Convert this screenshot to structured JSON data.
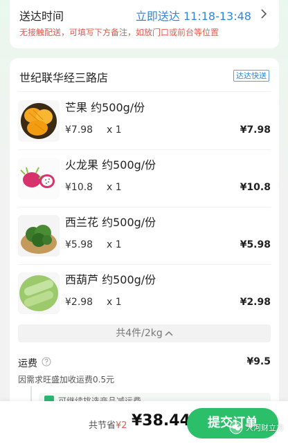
{
  "delivery": {
    "title": "送达时间",
    "time": "立即送达 11:18-13:48",
    "note": "无接触配送，可填写下方备注，如放门口或前台等位置"
  },
  "store": {
    "name": "世纪联华经三路店",
    "badge": "达达快送"
  },
  "items": [
    {
      "name": "芒果 约500g/份",
      "price": "¥7.98",
      "qty": "x 1",
      "total": "¥7.98",
      "icon": "mango-image"
    },
    {
      "name": "火龙果 约500g/份",
      "price": "¥10.8",
      "qty": "x 1",
      "total": "¥10.8",
      "icon": "dragon-fruit-image"
    },
    {
      "name": "西兰花 约500g/份",
      "price": "¥5.98",
      "qty": "x 1",
      "total": "¥5.98",
      "icon": "broccoli-image"
    },
    {
      "name": "西葫芦 约500g/份",
      "price": "¥2.98",
      "qty": "x 1",
      "total": "¥2.98",
      "icon": "zucchini-image"
    }
  ],
  "summary": {
    "text": "共4件/2kg"
  },
  "fee": {
    "label": "运费",
    "value": "¥9.5",
    "note": "因需求旺盛加收运费0.5元"
  },
  "promo": {
    "text": "可继续挑选商品减运费"
  },
  "checkout": {
    "saved_label": "共节省",
    "saved_amount": "¥2",
    "total": "¥38.44",
    "submit_label": "提交订单"
  },
  "watermark": {
    "text": "大河财立方"
  },
  "colors": {
    "accent_green": "#2bbf6a",
    "link_blue": "#2f86d8",
    "warning_red": "#e85a4f"
  }
}
